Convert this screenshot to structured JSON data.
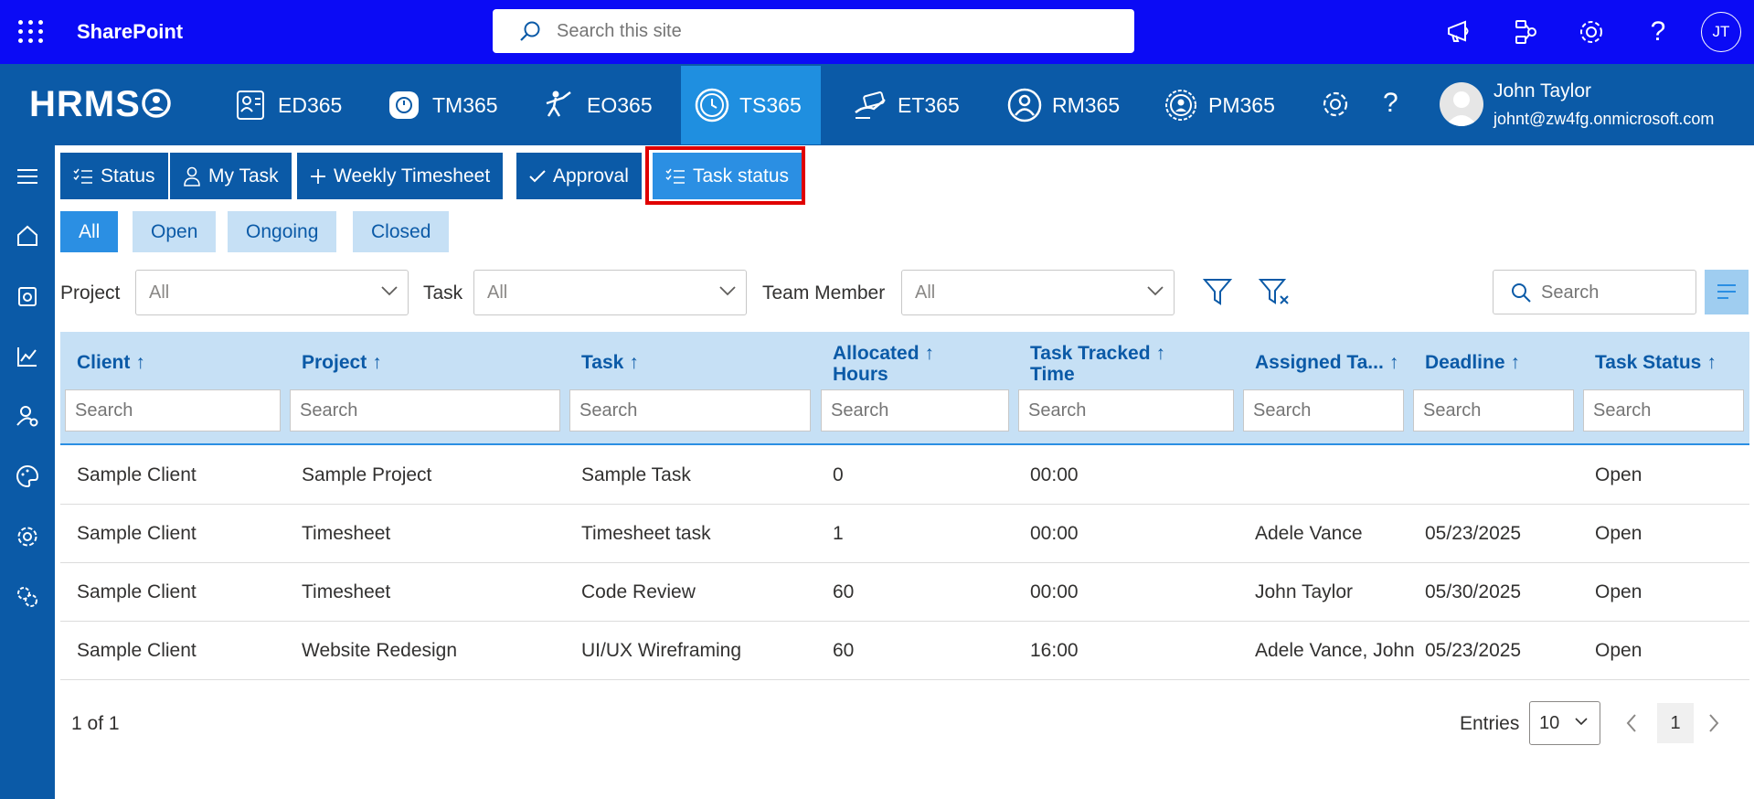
{
  "sharepoint": {
    "title": "SharePoint",
    "search_placeholder": "Search this site",
    "user_initials": "JT"
  },
  "hrms": {
    "logo": "HRMS",
    "modules": [
      {
        "label": "ED365",
        "icon": "employee-directory-icon"
      },
      {
        "label": "TM365",
        "icon": "time-management-icon"
      },
      {
        "label": "EO365",
        "icon": "onboarding-icon"
      },
      {
        "label": "TS365",
        "icon": "clock-icon",
        "active": true
      },
      {
        "label": "ET365",
        "icon": "expense-icon"
      },
      {
        "label": "RM365",
        "icon": "resource-icon"
      },
      {
        "label": "PM365",
        "icon": "performance-icon"
      }
    ],
    "user": {
      "name": "John Taylor",
      "email": "johnt@zw4fg.onmicrosoft.com"
    }
  },
  "tabs": [
    {
      "label": "Status",
      "icon": "checklist-icon"
    },
    {
      "label": "My Task",
      "icon": "person-icon"
    },
    {
      "label": "Weekly Timesheet",
      "icon": "plus-icon"
    },
    {
      "label": "Approval",
      "icon": "check-icon"
    },
    {
      "label": "Task status",
      "icon": "checklist-icon",
      "active": true
    }
  ],
  "status_filters": [
    {
      "label": "All",
      "active": true
    },
    {
      "label": "Open"
    },
    {
      "label": "Ongoing"
    },
    {
      "label": "Closed"
    }
  ],
  "filters": {
    "project_label": "Project",
    "project_value": "All",
    "task_label": "Task",
    "task_value": "All",
    "member_label": "Team Member",
    "member_value": "All",
    "search_placeholder": "Search"
  },
  "table": {
    "columns": [
      {
        "line1": "Client",
        "line2": ""
      },
      {
        "line1": "Project",
        "line2": ""
      },
      {
        "line1": "Task",
        "line2": ""
      },
      {
        "line1": "Allocated",
        "line2": "Hours"
      },
      {
        "line1": "Task Tracked",
        "line2": "Time"
      },
      {
        "line1": "Assigned Ta...",
        "line2": ""
      },
      {
        "line1": "Deadline",
        "line2": ""
      },
      {
        "line1": "Task Status",
        "line2": ""
      }
    ],
    "column_search_placeholder": "Search",
    "rows": [
      [
        "Sample Client",
        "Sample Project",
        "Sample Task",
        "0",
        "00:00",
        "",
        "",
        "Open"
      ],
      [
        "Sample Client",
        "Timesheet",
        "Timesheet task",
        "1",
        "00:00",
        "Adele Vance",
        "05/23/2025",
        "Open"
      ],
      [
        "Sample Client",
        "Timesheet",
        "Code Review",
        "60",
        "00:00",
        "John Taylor",
        "05/30/2025",
        "Open"
      ],
      [
        "Sample Client",
        "Website Redesign",
        "UI/UX Wireframing",
        "60",
        "16:00",
        "Adele Vance, John",
        "05/23/2025",
        "Open"
      ]
    ]
  },
  "pagination": {
    "info": "1 of 1",
    "entries_label": "Entries",
    "entries_value": "10",
    "current_page": "1"
  },
  "colors": {
    "sharepoint_bar": "#0b0bf5",
    "nav_blue": "#0b5aa7",
    "active_blue": "#2b8fe3",
    "light_blue": "#c6e0f5",
    "highlight_red": "#e00000"
  }
}
